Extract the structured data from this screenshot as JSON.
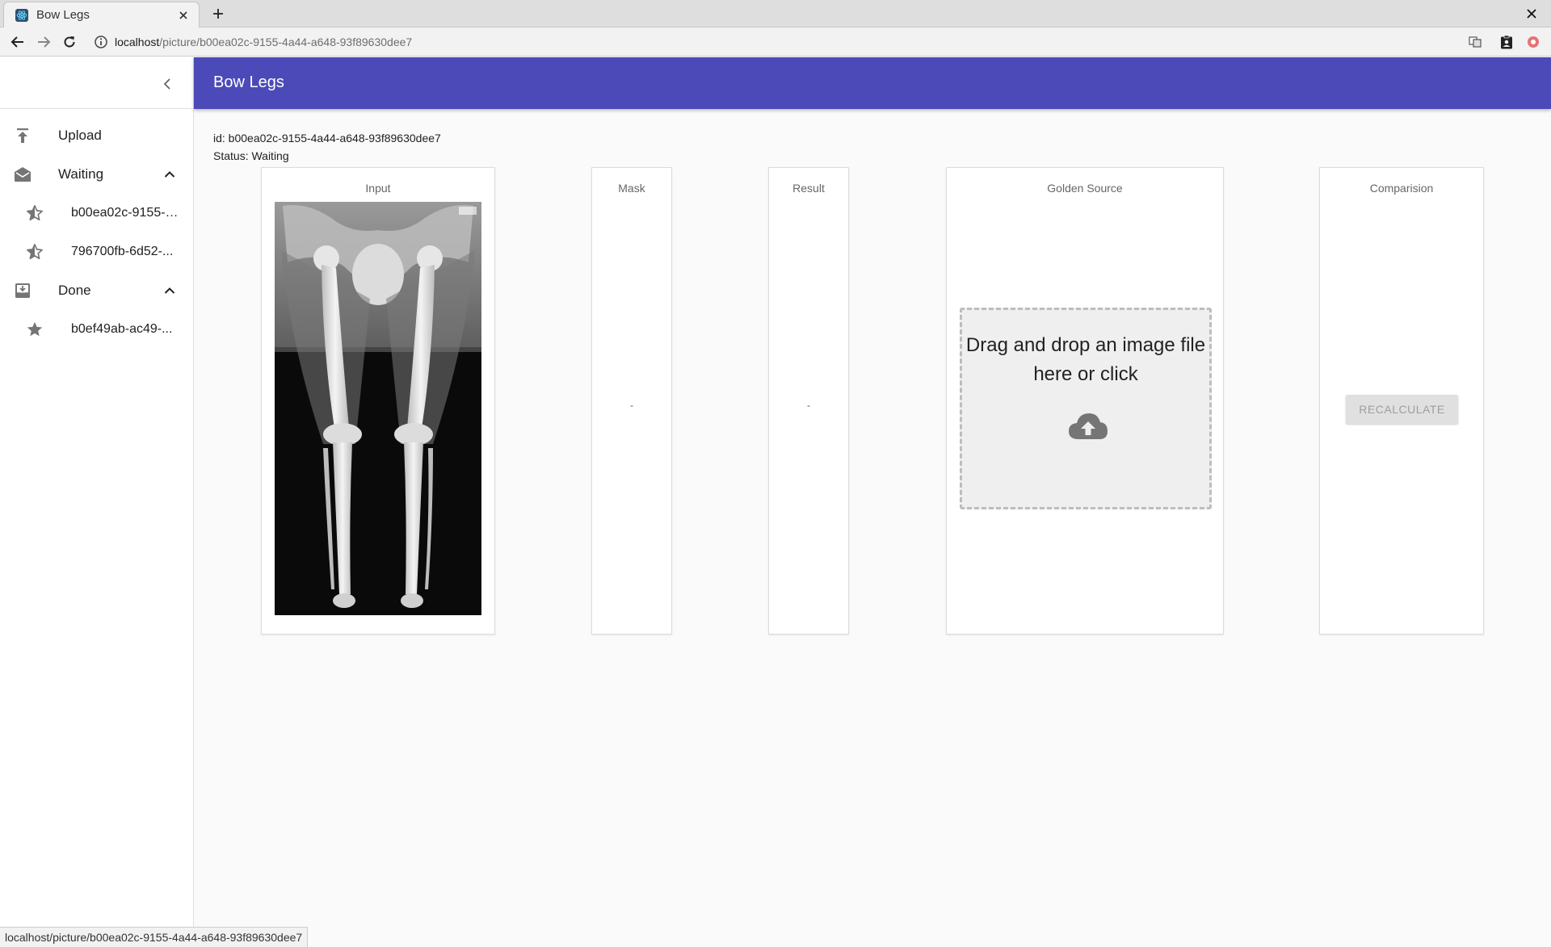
{
  "browser": {
    "tab_title": "Bow Legs",
    "url_host": "localhost",
    "url_path": "/picture/b00ea02c-9155-4a44-a648-93f89630dee7",
    "status_url": "localhost/picture/b00ea02c-9155-4a44-a648-93f89630dee7"
  },
  "app": {
    "title": "Bow Legs",
    "accent_color": "#4b4ab8"
  },
  "sidebar": {
    "upload_label": "Upload",
    "waiting": {
      "label": "Waiting",
      "items": [
        {
          "label": "b00ea02c-9155-4a44-a648-93f89630dee7",
          "icon": "star-half-icon"
        },
        {
          "label": "796700fb-6d52-...",
          "icon": "star-half-icon"
        }
      ]
    },
    "done": {
      "label": "Done",
      "items": [
        {
          "label": "b0ef49ab-ac49-...",
          "icon": "star-icon"
        }
      ]
    }
  },
  "picture": {
    "id_line": "id: b00ea02c-9155-4a44-a648-93f89630dee7",
    "status_line": "Status: Waiting"
  },
  "cards": {
    "input": {
      "title": "Input"
    },
    "mask": {
      "title": "Mask",
      "value": "-"
    },
    "result": {
      "title": "Result",
      "value": "-"
    },
    "golden": {
      "title": "Golden Source",
      "dropzone_text": "Drag and drop an image file here or click"
    },
    "comparison": {
      "title": "Comparision",
      "button_label": "Recalculate"
    }
  }
}
